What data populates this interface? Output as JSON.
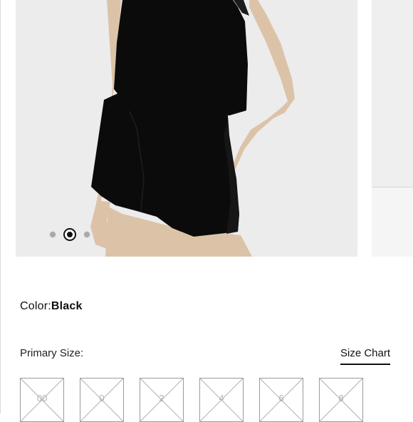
{
  "carousel": {
    "slide_count": 3,
    "active_index": 1,
    "colors": {
      "backdrop": "#ececed",
      "garment": "#0b0b0b",
      "skin": "#dcc3a8"
    }
  },
  "product": {
    "color_label": "Color:",
    "color_value": "Black",
    "primary_size_label": "Primary Size:",
    "size_chart_label": "Size Chart",
    "sizes": [
      "00",
      "0",
      "2",
      "4",
      "6",
      "8"
    ],
    "sizes_unavailable": true
  }
}
